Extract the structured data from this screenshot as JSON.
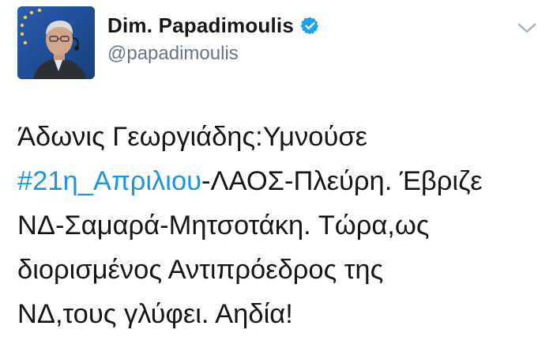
{
  "tweet": {
    "author": {
      "display_name": "Dim. Papadimoulis",
      "handle": "@papadimoulis",
      "avatar_icon": "profile-photo",
      "verified_icon": "verified-badge-icon"
    },
    "menu_icon": "chevron-down-icon",
    "text": {
      "line1": "Άδωνις Γεωργιάδης:Υμνούσε",
      "hashtag": "#21η_Απριλιου",
      "line2_rest": "-ΛΑΟΣ-Πλεύρη. Έβριζε",
      "line3": "ΝΔ-Σαμαρά-Μητσοτάκη. Τώρα,ως",
      "line4": "διορισμένος Αντιπρόεδρος της",
      "line5": "ΝΔ,τους γλύφει. Αηδία!"
    }
  },
  "colors": {
    "text": "#14171a",
    "secondary": "#657786",
    "link": "#1b95e0",
    "verified": "#1da1f2"
  }
}
